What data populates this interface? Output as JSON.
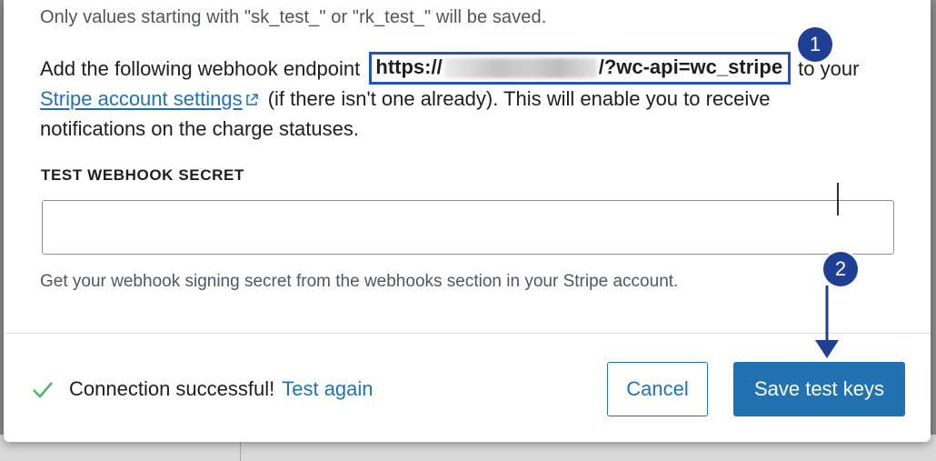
{
  "intro": {
    "info_line": "Only values starting with \"sk_test_\" or \"rk_test_\" will be saved."
  },
  "webhook": {
    "prefix": "Add the following webhook endpoint",
    "endpoint_start": "https://",
    "endpoint_end": "/?wc-api=wc_stripe",
    "after_endpoint": "to your",
    "settings_link": "Stripe account settings",
    "line2_rest": "(if there isn't one already). This will enable you to receive",
    "line3": "notifications on the charge statuses."
  },
  "secret_field": {
    "label": "TEST WEBHOOK SECRET",
    "value": "",
    "help": "Get your webhook signing secret from the webhooks section in your Stripe account."
  },
  "annotations": {
    "badge_1": "1",
    "badge_2": "2",
    "color": "#1f3f95"
  },
  "footer": {
    "status_text": "Connection successful!",
    "test_again": "Test again",
    "cancel": "Cancel",
    "save": "Save test keys"
  },
  "icons": {
    "external": "external-link-icon",
    "status": "check-icon",
    "arrow": "arrow-down-icon"
  },
  "colors": {
    "accent": "#2271b1",
    "success": "#4ab866",
    "highlight_border": "#1f56b5"
  }
}
